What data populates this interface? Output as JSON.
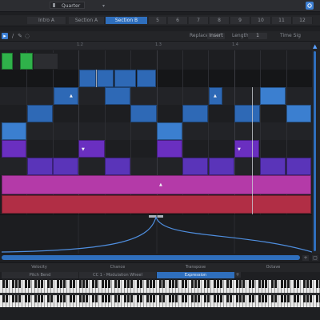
{
  "topbar": {
    "quantize_label": "Quarter",
    "dropdown_arrow": "▾",
    "right_button_icon": "gear-icon",
    "accent": "#3d7fd3"
  },
  "sections": [
    {
      "label": "Intro A",
      "active": false
    },
    {
      "label": "Section A",
      "active": false
    },
    {
      "label": "Section B",
      "active": true
    },
    {
      "label": "5",
      "active": false
    },
    {
      "label": "6",
      "active": false
    },
    {
      "label": "7",
      "active": false
    },
    {
      "label": "8",
      "active": false
    },
    {
      "label": "9",
      "active": false
    },
    {
      "label": "10",
      "active": false
    },
    {
      "label": "11",
      "active": false
    },
    {
      "label": "12",
      "active": false
    }
  ],
  "toolbar": {
    "tools": [
      "select-tool-icon",
      "draw-tool-icon",
      "pencil-tool-icon",
      "erase-tool-icon"
    ],
    "replace_label": "Replace",
    "insert_value": "Insert",
    "length_label": "Length",
    "length_value": "1",
    "time_sig_label": "Time Sig"
  },
  "ruler": [
    "1.2",
    "1.3",
    "1.4"
  ],
  "automation_lanes": [
    "Velocity",
    "Chance",
    "Transpose",
    "Octave"
  ],
  "cc_lanes": [
    "Pitch Bend",
    "CC 1 - Modulation Wheel",
    "Expression"
  ],
  "colors": {
    "blue": "#2e69b6",
    "violet": "#6a2fc0",
    "magenta": "#b43aa8",
    "red": "#b12e45",
    "green": "#2fb24a"
  }
}
